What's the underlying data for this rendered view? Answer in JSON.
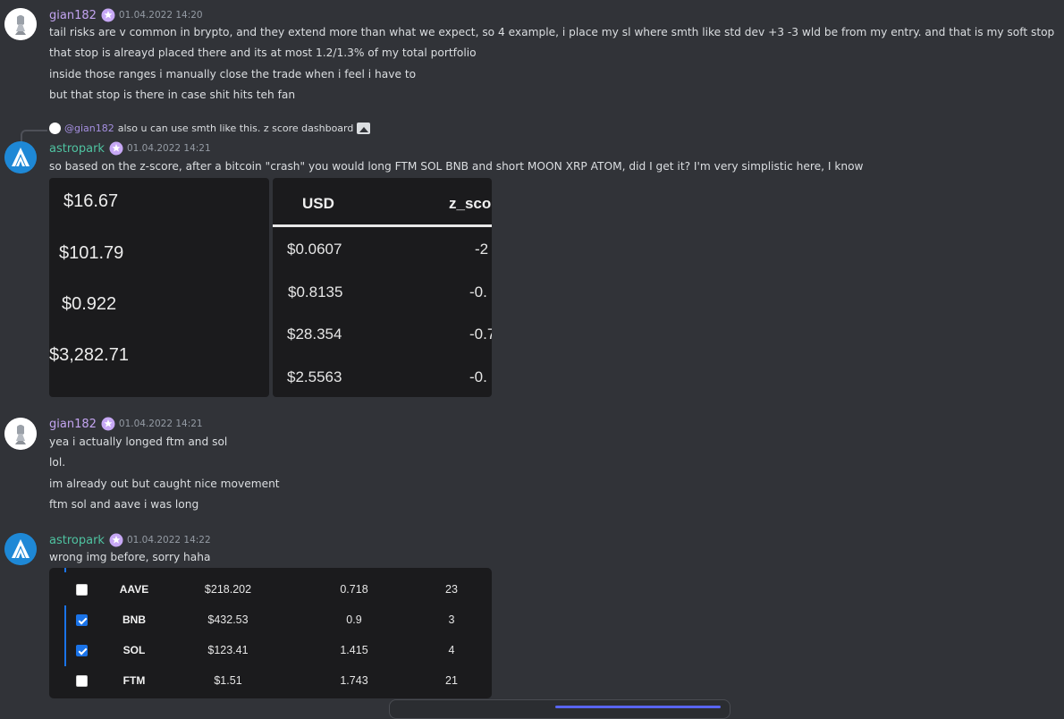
{
  "messages": [
    {
      "user": "gian182",
      "timestamp": "01.04.2022 14:20",
      "lines": [
        "tail risks are v common in brypto, and they extend more than what we expect, so 4 example, i place my sl where smth like std dev +3 -3 wld be from my entry. and that is my soft stop",
        "that stop is alreayd placed there and its at most 1.2/1.3% of my total portfolio",
        "inside those ranges i manually close the trade when i feel i have to",
        "but that stop is there in case shit hits teh fan"
      ]
    },
    {
      "reply": {
        "user": "@gian182",
        "text": "also u can use smth like this. z score dashboard"
      },
      "user": "astropark",
      "timestamp": "01.04.2022 14:21",
      "lines": [
        "so based on the z-score, after a bitcoin \"crash\" you would long FTM SOL BNB and short MOON XRP ATOM, did I get it? I'm very simplistic here, I know"
      ],
      "image_left": {
        "prices": [
          "$16.67",
          "$101.79",
          "$0.922",
          "$3,282.71"
        ]
      },
      "image_right": {
        "headers": [
          "USD",
          "z_sco"
        ],
        "rows": [
          [
            "$0.0607",
            "-2"
          ],
          [
            "$0.8135",
            "-0."
          ],
          [
            "$28.354",
            "-0.7"
          ],
          [
            "$2.5563",
            "-0."
          ]
        ]
      }
    },
    {
      "user": "gian182",
      "timestamp": "01.04.2022 14:21",
      "lines": [
        "yea i actually longed ftm and sol",
        "lol.",
        "im already out but caught nice movement",
        "ftm sol and aave i was long"
      ]
    },
    {
      "user": "astropark",
      "timestamp": "01.04.2022 14:22",
      "lines": [
        "wrong img before, sorry haha"
      ],
      "table": {
        "rows": [
          {
            "checked": false,
            "symbol": "AAVE",
            "price": "$218.202",
            "z": "0.718",
            "rank": "23"
          },
          {
            "checked": true,
            "symbol": "BNB",
            "price": "$432.53",
            "z": "0.9",
            "rank": "3"
          },
          {
            "checked": true,
            "symbol": "SOL",
            "price": "$123.41",
            "z": "1.415",
            "rank": "4"
          },
          {
            "checked": false,
            "symbol": "FTM",
            "price": "$1.51",
            "z": "1.743",
            "rank": "21"
          }
        ]
      }
    }
  ],
  "colors": {
    "background": "#313338",
    "gian_name": "#c3a4f0",
    "astro_name": "#4fc3a1",
    "accent": "#1a73e8"
  }
}
